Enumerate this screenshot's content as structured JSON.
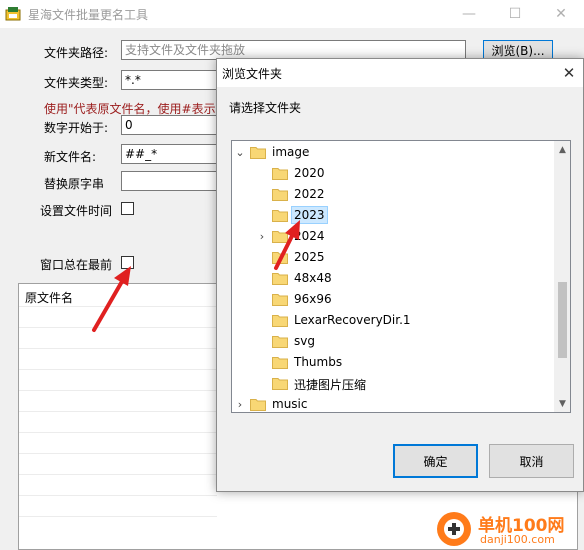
{
  "main_window": {
    "title": "星海文件批量更名工具",
    "controls": {
      "minimize": "—",
      "maximize": "☐",
      "close": "✕"
    },
    "form": {
      "folder_path_label": "文件夹路径:",
      "folder_path_placeholder": "支持文件及文件夹拖放",
      "browse_label": "浏览(B)...",
      "folder_type_label": "文件夹类型:",
      "folder_type_value": "*.*",
      "hint": "使用\"代表原文件名，使用#表示数",
      "start_number_label": "数字开始于:",
      "start_number_value": "0",
      "new_name_label": "新文件名:",
      "new_name_value": "##_*",
      "replace_label": "替换原字串",
      "replace_value": "",
      "set_time_label": "设置文件时间",
      "always_on_top_label": "窗口总在最前"
    },
    "table": {
      "columns": [
        "原文件名"
      ]
    }
  },
  "dialog": {
    "title": "浏览文件夹",
    "close": "✕",
    "prompt": "请选择文件夹",
    "tree": [
      {
        "label": "image",
        "level": 0,
        "toggle": "expanded"
      },
      {
        "label": "2020",
        "level": 1,
        "toggle": "none"
      },
      {
        "label": "2022",
        "level": 1,
        "toggle": "none"
      },
      {
        "label": "2023",
        "level": 1,
        "toggle": "none",
        "selected": true
      },
      {
        "label": "2024",
        "level": 1,
        "toggle": "collapsed"
      },
      {
        "label": "2025",
        "level": 1,
        "toggle": "none"
      },
      {
        "label": "48x48",
        "level": 1,
        "toggle": "none"
      },
      {
        "label": "96x96",
        "level": 1,
        "toggle": "none"
      },
      {
        "label": "LexarRecoveryDir.1",
        "level": 1,
        "toggle": "none"
      },
      {
        "label": "svg",
        "level": 1,
        "toggle": "none"
      },
      {
        "label": "Thumbs",
        "level": 1,
        "toggle": "none"
      },
      {
        "label": "迅捷图片压缩",
        "level": 1,
        "toggle": "none"
      },
      {
        "label": "music",
        "level": 0,
        "toggle": "collapsed"
      }
    ],
    "ok_label": "确定",
    "cancel_label": "取消"
  },
  "watermark": {
    "site": "单机100网",
    "url": "danji100.com"
  },
  "colors": {
    "accent": "#0078d7",
    "hint_red": "#9b1c1c",
    "folder": "#f8d775",
    "selection": "#cce8ff",
    "arrow": "#e02020",
    "watermark": "#ff7b1a"
  }
}
